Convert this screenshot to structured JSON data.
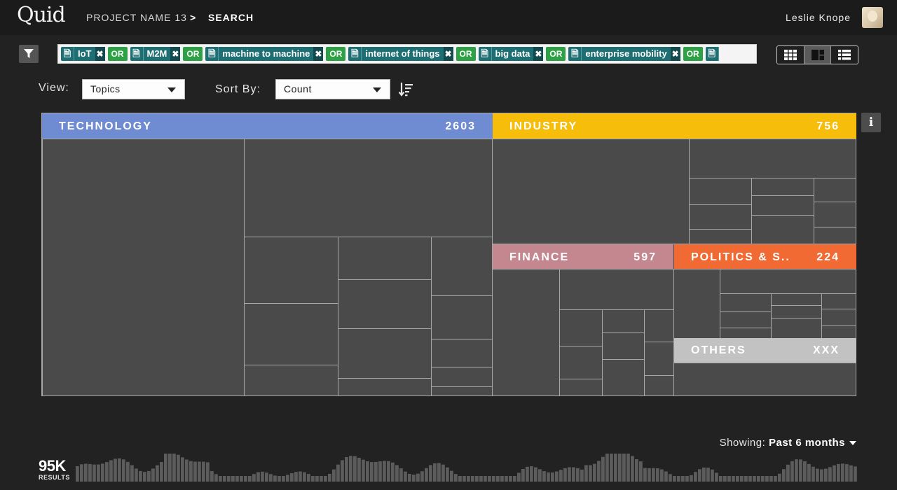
{
  "header": {
    "logo": "Quid",
    "project": "PROJECT NAME 13",
    "separator": ">",
    "page": "SEARCH",
    "user": "Leslie Knope"
  },
  "query": {
    "terms": [
      "IoT",
      "M2M",
      "machine to machine",
      "internet of things",
      "big data",
      "enterprise mobility"
    ],
    "operator": "OR"
  },
  "controls": {
    "view_label": "View:",
    "view_value": "Topics",
    "sort_label": "Sort By:",
    "sort_value": "Count"
  },
  "topics": {
    "technology": {
      "name": "TECHNOLOGY",
      "count": "2603",
      "color": "#6f8bd2"
    },
    "industry": {
      "name": "INDUSTRY",
      "count": "756",
      "color": "#f6be0b"
    },
    "finance": {
      "name": "FINANCE",
      "count": "597",
      "color": "#c48790"
    },
    "politics": {
      "name": "POLITICS & S..",
      "count": "224",
      "color": "#f26a33"
    },
    "others": {
      "name": "OTHERS",
      "count": "XXX",
      "color": "#c2c2c2"
    }
  },
  "timeline": {
    "showing_label": "Showing:",
    "range": "Past 6 months",
    "results_count": "95K",
    "results_label": "RESULTS"
  }
}
